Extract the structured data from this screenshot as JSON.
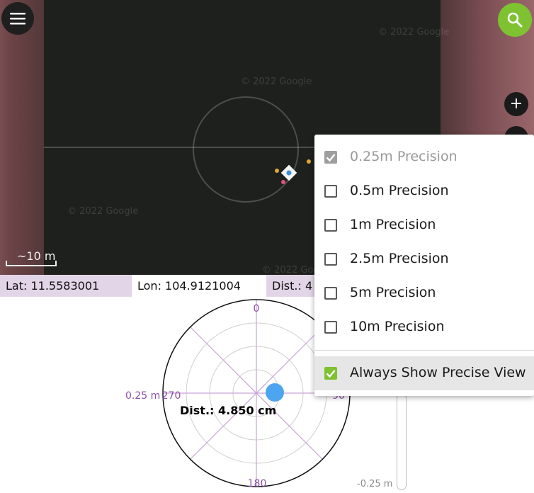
{
  "map": {
    "watermarks": [
      "© 2022 Google",
      "© 2022 Google",
      "© 2022 Google",
      "© 2022 Google"
    ],
    "scale_label": "~10 m",
    "menu_icon": "hamburger-menu-icon",
    "search_icon": "search-icon",
    "zoom_in_label": "+",
    "accent_color": "#7ec231"
  },
  "info": {
    "lat": "Lat: 11.5583001",
    "lon": "Lon: 104.9121004",
    "dist": "Dist.: 4"
  },
  "polar": {
    "label_0": "0",
    "label_90": "90",
    "label_180": "180",
    "label_270": "270",
    "range_label": "0.25 m",
    "distance": "Dist.: 4.850 cm"
  },
  "vertical_bar": {
    "bottom_label": "-0.25 m"
  },
  "precision_menu": {
    "items": [
      {
        "label": "0.25m Precision",
        "checked": true,
        "disabled": true
      },
      {
        "label": "0.5m Precision",
        "checked": false,
        "disabled": false
      },
      {
        "label": "1m Precision",
        "checked": false,
        "disabled": false
      },
      {
        "label": "2.5m Precision",
        "checked": false,
        "disabled": false
      },
      {
        "label": "5m Precision",
        "checked": false,
        "disabled": false
      },
      {
        "label": "10m Precision",
        "checked": false,
        "disabled": false
      }
    ],
    "always_show": {
      "label": "Always Show Precise View",
      "checked": true
    }
  }
}
